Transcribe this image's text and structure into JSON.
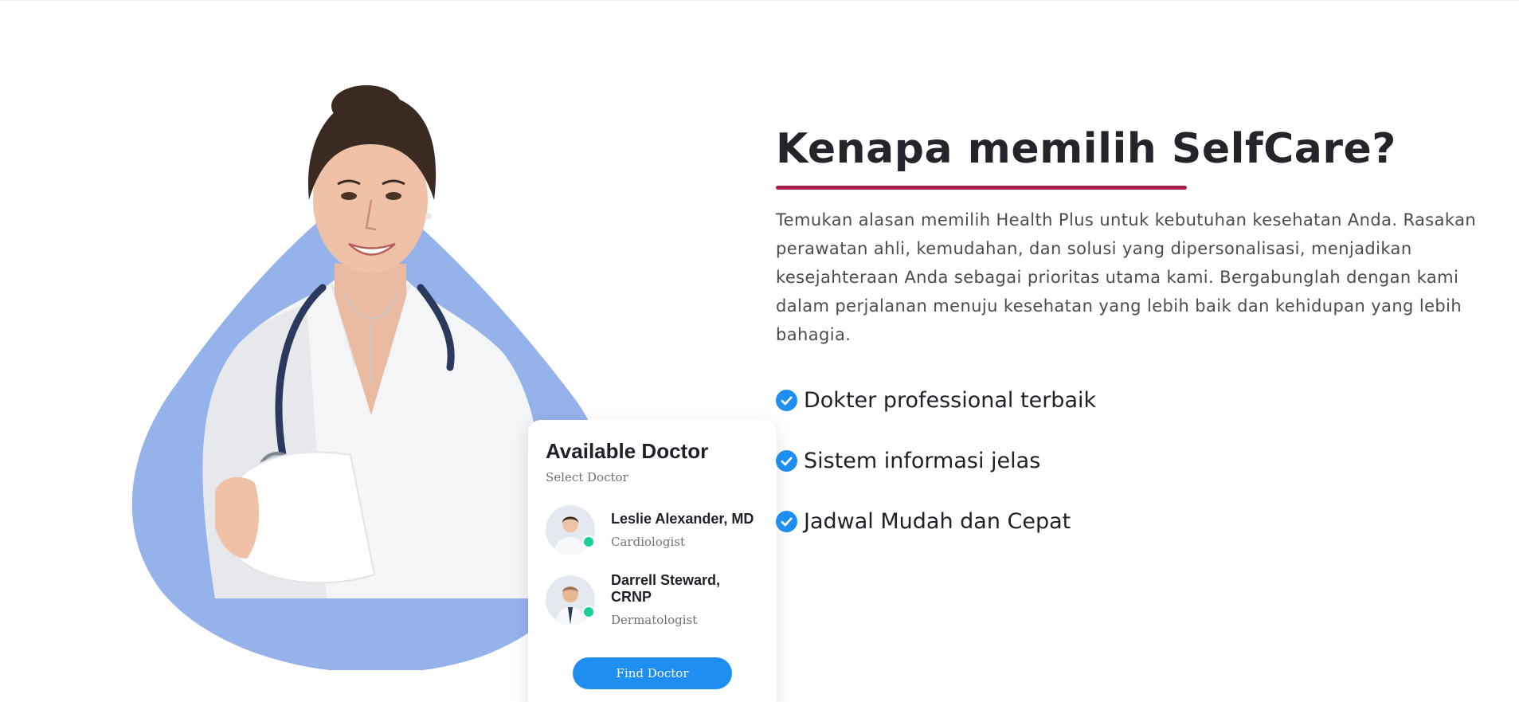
{
  "card": {
    "title": "Available Doctor",
    "subtitle": "Select Doctor",
    "doctors": [
      {
        "name": "Leslie Alexander, MD",
        "specialty": "Cardiologist",
        "status": "online"
      },
      {
        "name": "Darrell Steward, CRNP",
        "specialty": "Dermatologist",
        "status": "online"
      }
    ],
    "button_label": "Find Doctor"
  },
  "section": {
    "title": "Kenapa memilih SelfCare?",
    "description": "Temukan alasan memilih Health Plus untuk kebutuhan kesehatan Anda. Rasakan perawatan ahli, kemudahan, dan solusi yang dipersonalisasi, menjadikan kesejahteraan Anda sebagai prioritas utama kami. Bergabunglah dengan kami dalam perjalanan menuju kesehatan yang lebih baik dan kehidupan yang lebih bahagia.",
    "features": [
      {
        "label": "Dokter professional terbaik",
        "icon": "check-circle-icon"
      },
      {
        "label": "Sistem informasi jelas",
        "icon": "check-circle-icon"
      },
      {
        "label": "Jadwal Mudah dan Cepat",
        "icon": "check-circle-icon"
      }
    ]
  },
  "colors": {
    "accent_underline": "#a51f4f",
    "blob": "#95b2ea",
    "primary_blue": "#1e8ef1",
    "online_status": "#1ccf9a",
    "heading_text": "#23252b",
    "body_text": "#4a4c52"
  }
}
